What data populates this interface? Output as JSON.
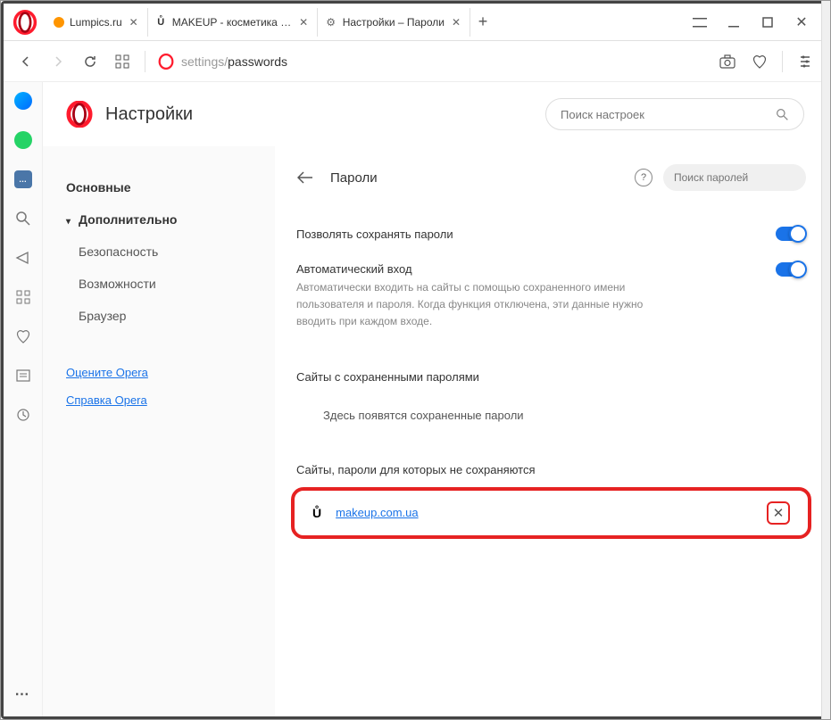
{
  "tabs": [
    {
      "label": "Lumpics.ru",
      "icon": "orange"
    },
    {
      "label": "MAKEUP - косметика и па",
      "icon": "makeup"
    },
    {
      "label": "Настройки – Пароли",
      "icon": "gear"
    }
  ],
  "url": {
    "prefix": "settings/",
    "path": "passwords"
  },
  "settings": {
    "title": "Настройки",
    "search_placeholder": "Поиск настроек",
    "nav": {
      "basic": "Основные",
      "advanced": "Дополнительно",
      "security": "Безопасность",
      "features": "Возможности",
      "browser": "Браузер",
      "rate": "Оцените Opera",
      "help": "Справка Opera"
    }
  },
  "passwords": {
    "title": "Пароли",
    "search_placeholder": "Поиск паролей",
    "allow_save": "Позволять сохранять пароли",
    "auto_login_title": "Автоматический вход",
    "auto_login_desc": "Автоматически входить на сайты с помощью сохраненного имени пользователя и пароля. Когда функция отключена, эти данные нужно вводить при каждом входе.",
    "saved_title": "Сайты с сохраненными паролями",
    "saved_empty": "Здесь появятся сохраненные пароли",
    "never_title": "Сайты, пароли для которых не сохраняются",
    "never_site": "makeup.com.ua",
    "never_icon": "Ů"
  }
}
